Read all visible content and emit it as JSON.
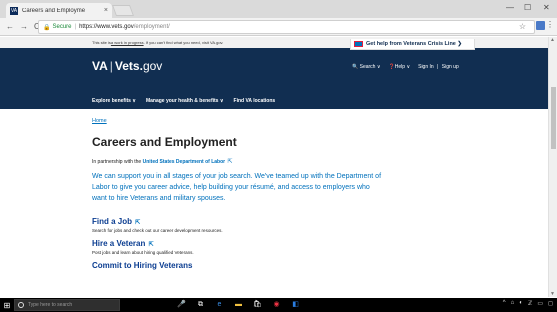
{
  "browser": {
    "tab_title": "Careers and Employme",
    "tab_close": "×",
    "minimize": "—",
    "restore": "☐",
    "close": "✕",
    "back": "←",
    "forward": "→",
    "reload": "C",
    "secure_label": "Secure",
    "url_host": "https://www.vets.gov",
    "url_path": "/employment/",
    "star": "☆",
    "menu": "⋮"
  },
  "govbar": {
    "text_pre": "This site is ",
    "text_link": "a work in progress",
    "text_post": ". If you can't find what you need, visit VA.gov."
  },
  "crisis_line": "Get help from Veterans Crisis Line ❯",
  "logo": {
    "va": "VA",
    "pipe": "|",
    "site": "Vets.",
    "tld": "gov"
  },
  "header_right": {
    "search": "Search ∨",
    "help": "Help ∨",
    "sign_in": "Sign In",
    "sep": "|",
    "sign_up": "Sign up"
  },
  "nav": {
    "items": [
      {
        "label": "Explore benefits ∨"
      },
      {
        "label": "Manage your health & benefits ∨"
      },
      {
        "label": "Find VA locations"
      }
    ]
  },
  "breadcrumb": "Home",
  "page_title": "Careers and Employment",
  "partnership": {
    "prefix": "In partnership with the ",
    "org": "United States Department of Labor"
  },
  "lead": "We can support you in all stages of your job search. We've teamed up with the Department of Labor to give you career advice, help building your résumé, and access to employers who want to hire Veterans and military spouses.",
  "sections": [
    {
      "title": "Find a Job",
      "desc": "Search for jobs and check out our career development resources."
    },
    {
      "title": "Hire a Veteran",
      "desc": "Post jobs and learn about hiring qualified Veterans."
    },
    {
      "title": "Commit to Hiring Veterans",
      "desc": ""
    }
  ],
  "external_icon": "⇱",
  "taskbar": {
    "search_placeholder": "Type here to search",
    "tray": [
      "^",
      "⌂",
      "◐",
      "ℤ",
      "▭",
      "◻"
    ]
  }
}
